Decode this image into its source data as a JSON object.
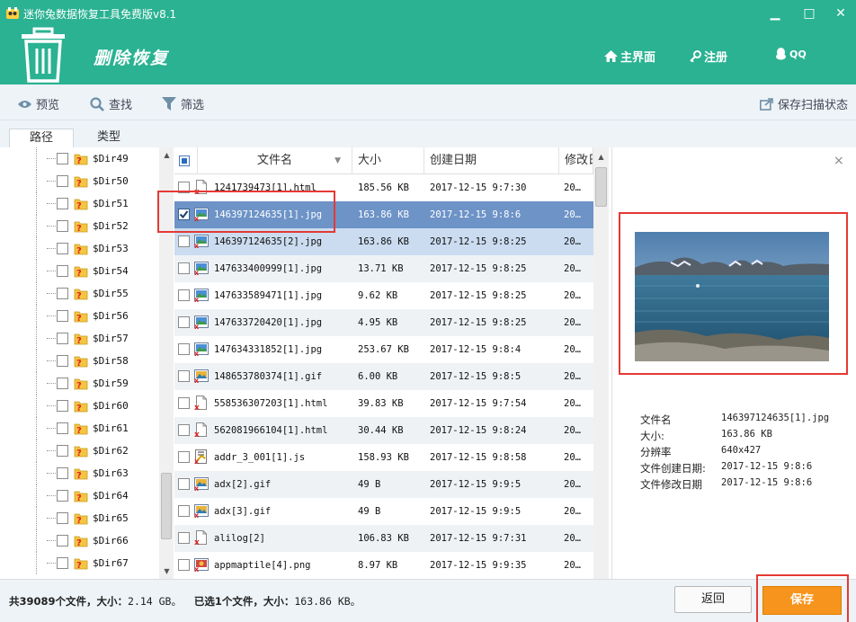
{
  "window": {
    "title": "迷你兔数据恢复工具免费版v8.1",
    "minimize": "▁",
    "restore": "□",
    "close": "✕"
  },
  "header": {
    "title": "删除恢复",
    "nav": {
      "home": "主界面",
      "register": "注册",
      "qq": "QQ"
    }
  },
  "toolbar": {
    "preview": "预览",
    "find": "查找",
    "filter": "筛选",
    "save_scan": "保存扫描状态"
  },
  "tabs": {
    "path": "路径",
    "type": "类型"
  },
  "tree": {
    "items": [
      "$Dir49",
      "$Dir50",
      "$Dir51",
      "$Dir52",
      "$Dir53",
      "$Dir54",
      "$Dir55",
      "$Dir56",
      "$Dir57",
      "$Dir58",
      "$Dir59",
      "$Dir60",
      "$Dir61",
      "$Dir62",
      "$Dir63",
      "$Dir64",
      "$Dir65",
      "$Dir66",
      "$Dir67"
    ]
  },
  "filelist": {
    "columns": {
      "name": "文件名",
      "size": "大小",
      "created": "创建日期",
      "modified": "修改日期"
    },
    "rows": [
      {
        "name": "1241739473[1].html",
        "size": "185.56 KB",
        "created": "2017-12-15 9:7:30",
        "modified": "20…",
        "icon": "html",
        "checked": false
      },
      {
        "name": "146397124635[1].jpg",
        "size": "163.86 KB",
        "created": "2017-12-15 9:8:6",
        "modified": "20…",
        "icon": "image",
        "checked": true
      },
      {
        "name": "146397124635[2].jpg",
        "size": "163.86 KB",
        "created": "2017-12-15 9:8:25",
        "modified": "20…",
        "icon": "image",
        "checked": false
      },
      {
        "name": "147633400999[1].jpg",
        "size": "13.71 KB",
        "created": "2017-12-15 9:8:25",
        "modified": "20…",
        "icon": "image",
        "checked": false
      },
      {
        "name": "147633589471[1].jpg",
        "size": "9.62 KB",
        "created": "2017-12-15 9:8:25",
        "modified": "20…",
        "icon": "image",
        "checked": false
      },
      {
        "name": "147633720420[1].jpg",
        "size": "4.95 KB",
        "created": "2017-12-15 9:8:25",
        "modified": "20…",
        "icon": "image",
        "checked": false
      },
      {
        "name": "147634331852[1].jpg",
        "size": "253.67 KB",
        "created": "2017-12-15 9:8:4",
        "modified": "20…",
        "icon": "image",
        "checked": false
      },
      {
        "name": "148653780374[1].gif",
        "size": "6.00 KB",
        "created": "2017-12-15 9:8:5",
        "modified": "20…",
        "icon": "gif",
        "checked": false
      },
      {
        "name": "558536307203[1].html",
        "size": "39.83 KB",
        "created": "2017-12-15 9:7:54",
        "modified": "20…",
        "icon": "html",
        "checked": false
      },
      {
        "name": "562081966104[1].html",
        "size": "30.44 KB",
        "created": "2017-12-15 9:8:24",
        "modified": "20…",
        "icon": "html",
        "checked": false
      },
      {
        "name": "addr_3_001[1].js",
        "size": "158.93 KB",
        "created": "2017-12-15 9:8:58",
        "modified": "20…",
        "icon": "js",
        "checked": false
      },
      {
        "name": "adx[2].gif",
        "size": "49 B",
        "created": "2017-12-15 9:9:5",
        "modified": "20…",
        "icon": "gif",
        "checked": false
      },
      {
        "name": "adx[3].gif",
        "size": "49 B",
        "created": "2017-12-15 9:9:5",
        "modified": "20…",
        "icon": "gif",
        "checked": false
      },
      {
        "name": "alilog[2]",
        "size": "106.83 KB",
        "created": "2017-12-15 9:7:31",
        "modified": "20…",
        "icon": "html",
        "checked": false
      },
      {
        "name": "appmaptile[4].png",
        "size": "8.97 KB",
        "created": "2017-12-15 9:9:35",
        "modified": "20…",
        "icon": "png",
        "checked": false
      }
    ]
  },
  "preview": {
    "close": "×",
    "info": [
      {
        "label": "文件名",
        "value": "146397124635[1].jpg"
      },
      {
        "label": "大小:",
        "value": "163.86 KB"
      },
      {
        "label": "分辨率",
        "value": "640x427"
      },
      {
        "label": "文件创建日期:",
        "value": "2017-12-15 9:8:6"
      },
      {
        "label": "文件修改日期",
        "value": "2017-12-15 9:8:6"
      }
    ]
  },
  "status": {
    "total_label": "共39089个文件，大小：",
    "total_size": "2.14 GB。",
    "selected_label": "已选1个文件，大小：",
    "selected_size": "163.86 KB。"
  },
  "buttons": {
    "back": "返回",
    "save": "保存"
  },
  "colors": {
    "header": "#2ab292",
    "selection": "#6d93c7",
    "save_button": "#f7941d",
    "highlight_box": "#e53935"
  }
}
